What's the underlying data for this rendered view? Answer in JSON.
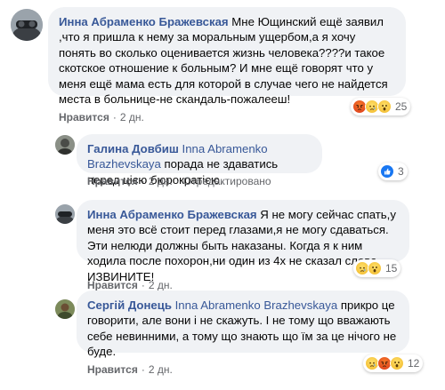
{
  "comments": [
    {
      "author": "Инна Абраменко Бражевская",
      "mention": "",
      "text": "Мне Ющинский ещё заявил ,что я пришла к нему за моральным ущербом,а я хочу понять во сколько оценивается жизнь человека????и такое скотское отношение к больным? И мне ещё говорят что у меня ещё мама есть для которой в случае чего не найдется места в больнице-не скандаль-пожалееш!",
      "like_label": "Нравится",
      "time": "2 дн.",
      "edited": "",
      "reaction_count": "25",
      "reactions": [
        "angry-icon",
        "sad-icon",
        "wow-icon"
      ]
    },
    {
      "author": "Галина Довбиш",
      "mention": "Inna Abramenko Brazhevskaya",
      "text": "порада не здаватись перед цією бюрократією.",
      "like_label": "Нравится",
      "time": "2 дн.",
      "edited": "Отредактировано",
      "reaction_count": "3",
      "reactions": [
        "like-icon"
      ]
    },
    {
      "author": "Инна Абраменко Бражевская",
      "mention": "",
      "text": "Я не могу сейчас спать,у меня это всё стоит перед глазами,я не могу сдаваться. Эти нелюди должны быть наказаны. Когда я к ним ходила после похорон,ни один из 4х не сказал слова ИЗВИНИТЕ!",
      "like_label": "Нравится",
      "time": "2 дн.",
      "edited": "",
      "reaction_count": "15",
      "reactions": [
        "sad-icon",
        "wow-icon"
      ]
    },
    {
      "author": "Сергій Донець",
      "mention": "Inna Abramenko Brazhevskaya",
      "text": "прикро це говорити, але вони і не скажуть. І не тому що вважають себе невинними, а тому що знають що їм за це нічого не буде.",
      "like_label": "Нравится",
      "time": "2 дн.",
      "edited": "",
      "reaction_count": "12",
      "reactions": [
        "sad-icon",
        "angry-icon",
        "wow-icon"
      ]
    }
  ],
  "colors": {
    "author": "#385898",
    "bubble": "#f0f2f5",
    "meta": "#65676b"
  }
}
